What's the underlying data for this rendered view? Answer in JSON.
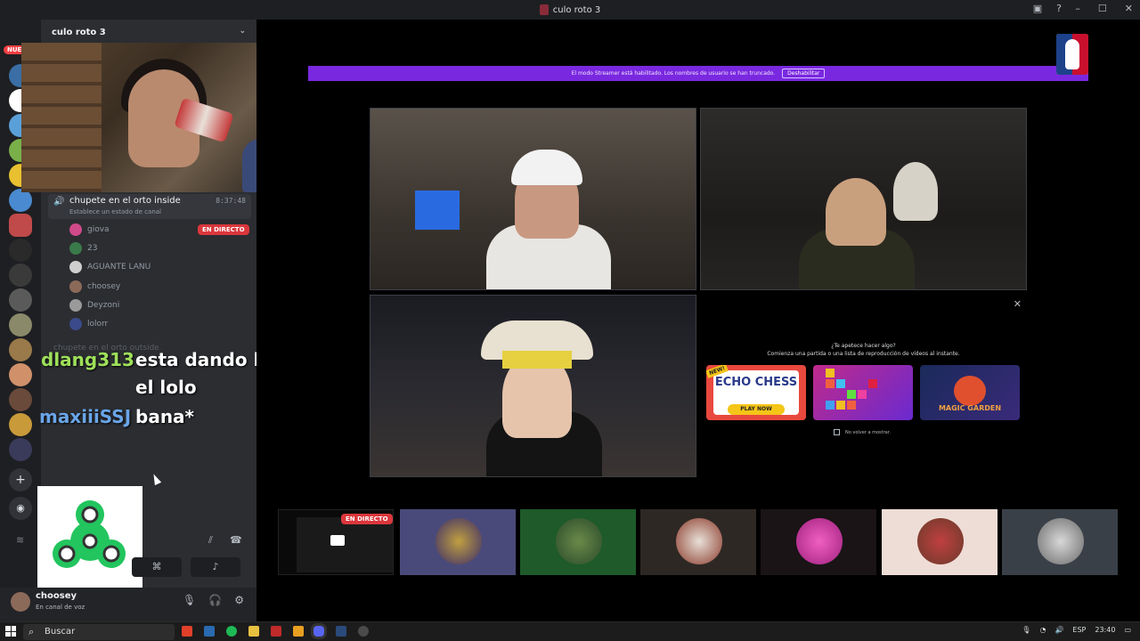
{
  "window": {
    "title": "culo roto 3"
  },
  "server": {
    "name": "culo roto 3",
    "new_badge": "NUEVO"
  },
  "voice_channel": {
    "name": "chupete en el orto inside",
    "time": "8:37:48",
    "status_prompt": "Establece un estado de canal",
    "live_label": "EN DIRECTO",
    "members": [
      {
        "name": "giova",
        "live": true
      },
      {
        "name": "23",
        "live": false
      },
      {
        "name": "AGUANTE LANU",
        "live": false
      },
      {
        "name": "choosey",
        "live": false
      },
      {
        "name": "Deyzoni",
        "live": false
      },
      {
        "name": "lolorr",
        "live": false
      }
    ],
    "next_channel": "chupete en el orto outside"
  },
  "chat_overlay": [
    {
      "user": "dlang313",
      "lines": [
        "esta dando la tesis",
        "el lolo"
      ]
    },
    {
      "user": "maxiiiSSJ",
      "lines": [
        "bana*"
      ]
    }
  ],
  "user_panel": {
    "username": "choosey",
    "status": "En canal de voz"
  },
  "stream": {
    "streamer_mode_notice": "El modo Streamer está habilitado. Los nombres de usuario se han truncado.",
    "disable_button": "Deshabilitar",
    "activity": {
      "question": "¿Te apetece hacer algo?",
      "subtitle": "Comienza una partida o una lista de reproducción de vídeos al instante.",
      "games": [
        {
          "name": "ECHO CHESS",
          "badge": "NEW!",
          "cta": "PLAY NOW"
        },
        {
          "name": "Blocks"
        },
        {
          "name": "MAGIC GARDEN"
        }
      ],
      "dont_show": "No volver a mostrar."
    },
    "participants_live_badge": "EN DIRECTO"
  },
  "taskbar": {
    "search_placeholder": "Buscar",
    "language": "ESP",
    "clock": "23:40"
  },
  "colors": {
    "accent": "#7a28e0",
    "live": "#da373c",
    "voice_green": "#23a55a"
  }
}
